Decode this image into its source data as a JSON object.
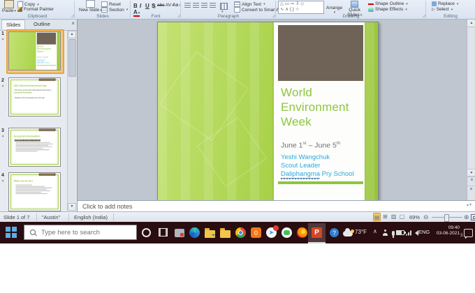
{
  "ribbon": {
    "clipboard": {
      "label": "Clipboard",
      "paste": "Paste",
      "copy": "Copy",
      "format_painter": "Format Painter"
    },
    "slides": {
      "label": "Slides",
      "new": "New",
      "slide": "Slide",
      "reset": "Reset",
      "section": "Section"
    },
    "font": {
      "label": "Font",
      "bold": "B",
      "italic": "I",
      "underline": "U",
      "shadow": "S",
      "strike": "abc",
      "spacing": "AV",
      "case": "Aa",
      "color": "A"
    },
    "paragraph": {
      "label": "Paragraph",
      "align_text": "Align Text",
      "smartart": "Convert to SmartArt"
    },
    "drawing": {
      "label": "Drawing",
      "shapes_row1": "△ ▭ ⇨ ⇩ ◇",
      "shapes_row2": "∿ ∧ { } ☆",
      "arrange": "Arrange",
      "quick": "Quick",
      "styles": "Styles",
      "shape_outline": "Shape Outline",
      "shape_effects": "Shape Effects"
    },
    "editing": {
      "label": "Editing",
      "replace": "Replace",
      "select": "Select"
    }
  },
  "slides_panel": {
    "tab_slides": "Slides",
    "tab_outline": "Outline",
    "thumbs": [
      {
        "number": "1"
      },
      {
        "number": "2",
        "title": "2021 World Environment Day",
        "b1a": "The theme of this year's World Environment Day is",
        "b1b": "Ecosystem Restoration.",
        "b2": "Pakistan will act as global host of the day."
      },
      {
        "number": "3",
        "title": "Ecosystem Restoration",
        "b1": "REIMAGINE. RECREATE. RESTORE."
      },
      {
        "number": "4",
        "title": "What can we do?"
      }
    ]
  },
  "slide": {
    "title_l1": "World",
    "title_l2": "Environment",
    "title_l3": "Week",
    "date_p1": "June 1",
    "date_s1": "st",
    "date_p2": " – June 5",
    "date_s2": "th",
    "date_full": "June 1st – June 5th",
    "author": "Yeshi Wangchuk",
    "role": "Scout Leader",
    "school_u": "Daliphangma",
    "school_rest": "Pry School",
    "school_full": "Daliphangma Pry School"
  },
  "notes": {
    "placeholder": "Click to add notes"
  },
  "status": {
    "slide_indicator": "Slide 1 of 7",
    "theme": "\"Austin\"",
    "language": "English (India)",
    "zoom_level": "69%"
  },
  "taskbar": {
    "search_placeholder": "Type here to search",
    "temperature": "73°F",
    "lang": "ENG",
    "time": "09:40",
    "date": "03-06-2021",
    "notif_count": "3"
  },
  "colors": {
    "accent_green": "#8dc63f",
    "hyperlink_blue": "#2aa9e0",
    "selection_orange": "#e8a33d",
    "taskbar": "#2a0d10",
    "ppt_orange": "#d24726"
  }
}
